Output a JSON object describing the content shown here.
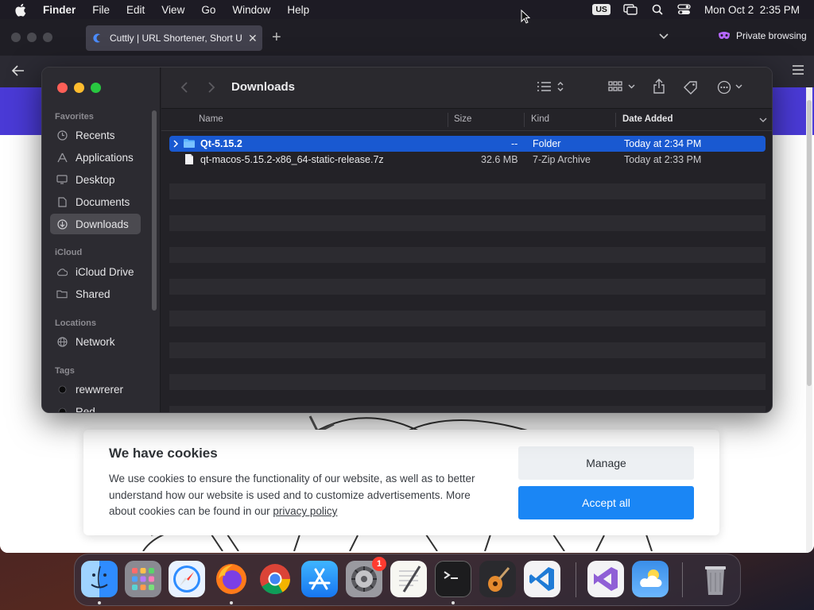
{
  "menubar": {
    "app_name": "Finder",
    "items": [
      "File",
      "Edit",
      "View",
      "Go",
      "Window",
      "Help"
    ],
    "input_source": "US",
    "datetime": "Mon Oct 2  2:35 PM"
  },
  "browser": {
    "tab_title": "Cuttly | URL Shortener, Short U",
    "private_label": "Private browsing"
  },
  "cookie_banner": {
    "title": "We have cookies",
    "text": "We use cookies to ensure the functionality of our website, as well as to better understand how our website is used and to customize advertisements. More about cookies can be found in our ",
    "link": "privacy policy",
    "manage_label": "Manage",
    "accept_label": "Accept all"
  },
  "finder": {
    "title": "Downloads",
    "sidebar": {
      "favorites_label": "Favorites",
      "favorites": [
        {
          "label": "Recents",
          "icon": "clock-icon"
        },
        {
          "label": "Applications",
          "icon": "applications-icon"
        },
        {
          "label": "Desktop",
          "icon": "desktop-icon"
        },
        {
          "label": "Documents",
          "icon": "document-icon"
        },
        {
          "label": "Downloads",
          "icon": "download-icon"
        }
      ],
      "icloud_label": "iCloud",
      "icloud": [
        {
          "label": "iCloud Drive",
          "icon": "cloud-icon"
        },
        {
          "label": "Shared",
          "icon": "shared-folder-icon"
        }
      ],
      "locations_label": "Locations",
      "locations": [
        {
          "label": "Network",
          "icon": "globe-icon"
        }
      ],
      "tags_label": "Tags",
      "tags": [
        {
          "label": "rewwrerer",
          "color": "#111111"
        },
        {
          "label": "Red",
          "color": "#111111"
        }
      ]
    },
    "columns": {
      "name": "Name",
      "size": "Size",
      "kind": "Kind",
      "date": "Date Added"
    },
    "files": [
      {
        "name": "Qt-5.15.2",
        "size": "--",
        "kind": "Folder",
        "date": "Today at 2:34 PM",
        "selected": true
      },
      {
        "name": "qt-macos-5.15.2-x86_64-static-release.7z",
        "size": "32.6 MB",
        "kind": "7-Zip Archive",
        "date": "Today at 2:33 PM",
        "selected": false
      }
    ]
  },
  "dock": {
    "apps": [
      "Finder",
      "Launchpad",
      "Safari",
      "Firefox",
      "Chrome",
      "App Store",
      "System Settings",
      "TextEdit",
      "Terminal",
      "GarageBand",
      "Visual Studio Code",
      "Visual Studio",
      "Weather",
      "Trash"
    ],
    "settings_badge": "1"
  },
  "colors": {
    "selection": "#1959d1",
    "accept_button": "#1a86f5",
    "site_header": "#4a3ad6"
  }
}
